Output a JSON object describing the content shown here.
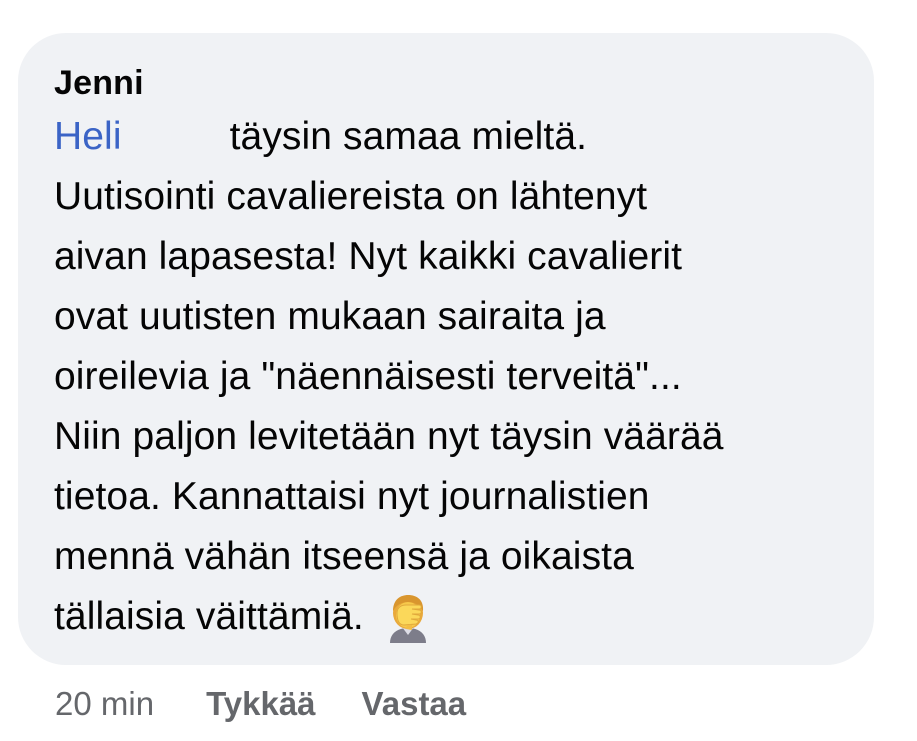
{
  "comment": {
    "author": "Jenni",
    "mention": "Heli",
    "lines": [
      "täysin samaa mieltä.",
      "Uutisointi cavaliereista on lähtenyt",
      "aivan lapasesta! Nyt kaikki cavalierit",
      "ovat uutisten mukaan sairaita ja",
      "oireilevia ja \"näennäisesti terveitä\"...",
      "Niin paljon levitetään nyt täysin väärää",
      "tietoa. Kannattaisi nyt journalistien",
      "mennä vähän itseensä ja oikaista",
      "tällaisia väittämiä."
    ],
    "emoji": "facepalm-emoji"
  },
  "meta": {
    "time": "20 min",
    "like_label": "Tykkää",
    "reply_label": "Vastaa"
  },
  "colors": {
    "bubble_bg": "#f0f2f5",
    "mention": "#3b64c6",
    "meta_text": "#65676b",
    "text": "#050505"
  }
}
